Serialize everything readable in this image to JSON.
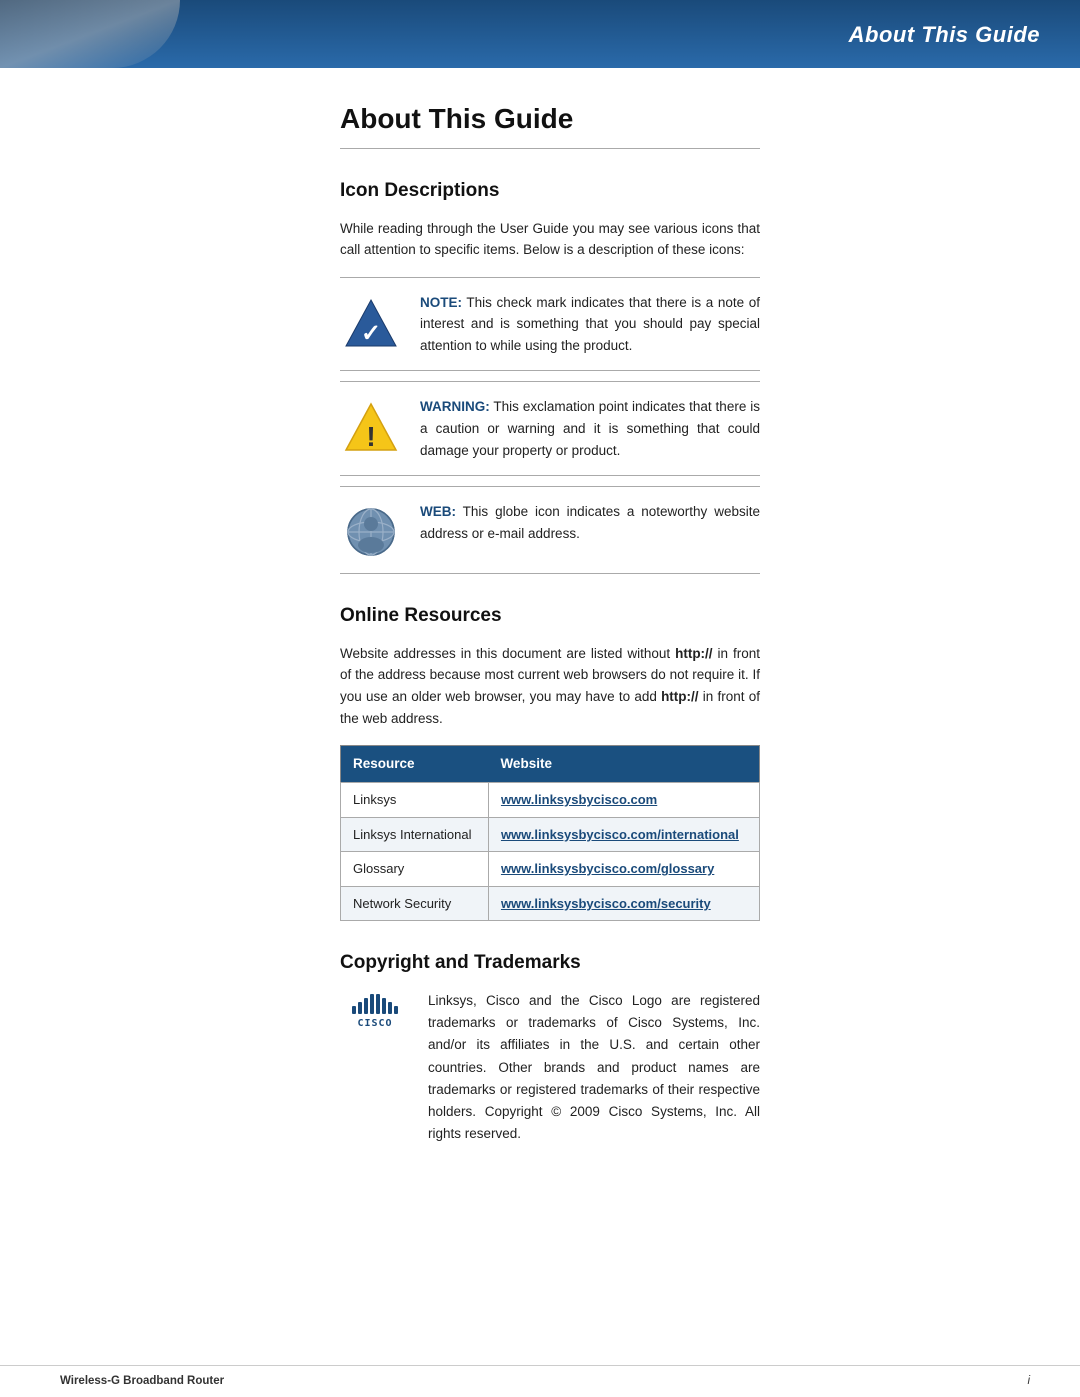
{
  "header": {
    "title": "About This Guide",
    "decoration": true
  },
  "page": {
    "title": "About This Guide",
    "sections": {
      "icon_descriptions": {
        "heading": "Icon Descriptions",
        "intro": "While reading through the User Guide you may see various icons that call attention to specific items. Below is a description of these icons:",
        "icons": [
          {
            "type": "note",
            "label": "NOTE:",
            "text": " This check mark indicates that there is a note of interest and is something that you should pay special attention to while using the product."
          },
          {
            "type": "warning",
            "label": "WARNING:",
            "text": " This exclamation point indicates that there is a caution or warning and it is something that could damage your property or product."
          },
          {
            "type": "web",
            "label": "WEB:",
            "text": " This globe icon indicates a noteworthy website address or e-mail address."
          }
        ]
      },
      "online_resources": {
        "heading": "Online Resources",
        "text": "Website addresses in this document are listed without http:// in front of the address because most current web browsers do not require it. If you use an older web browser, you may have to add http:// in front of the web address.",
        "bold_fragments": [
          "http://",
          "http://"
        ],
        "table": {
          "headers": [
            "Resource",
            "Website"
          ],
          "rows": [
            [
              "Linksys",
              "www.linksysbycisco.com"
            ],
            [
              "Linksys International",
              "www.linksysbycisco.com/international"
            ],
            [
              "Glossary",
              "www.linksysbycisco.com/glossary"
            ],
            [
              "Network Security",
              "www.linksysbycisco.com/security"
            ]
          ]
        }
      },
      "copyright": {
        "heading": "Copyright and Trademarks",
        "text": "Linksys, Cisco and the Cisco Logo are registered trademarks or trademarks of Cisco Systems, Inc. and/or its affiliates in the U.S. and certain other countries. Other brands and product names are trademarks or registered trademarks of their respective holders. Copyright © 2009 Cisco Systems, Inc. All rights reserved.",
        "logo_top": "ılıılı.",
        "logo_bottom": "CISCO"
      }
    }
  },
  "footer": {
    "product": "Wireless-G Broadband Router",
    "page": "i"
  }
}
